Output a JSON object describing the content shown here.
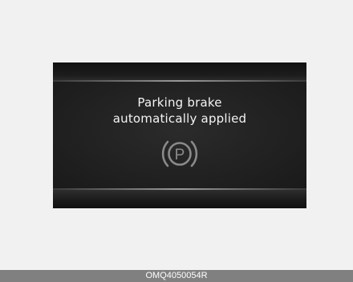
{
  "display": {
    "message_line1": "Parking brake",
    "message_line2": "automatically applied",
    "icon": "parking-brake-icon",
    "icon_letter": "P"
  },
  "caption": {
    "code": "OMQ4050054R"
  },
  "colors": {
    "page_background": "#f1f1f1",
    "display_background": "#202020",
    "text": "#f4f4f4",
    "icon": "#8a8a8a",
    "caption_bar": "#808080"
  }
}
